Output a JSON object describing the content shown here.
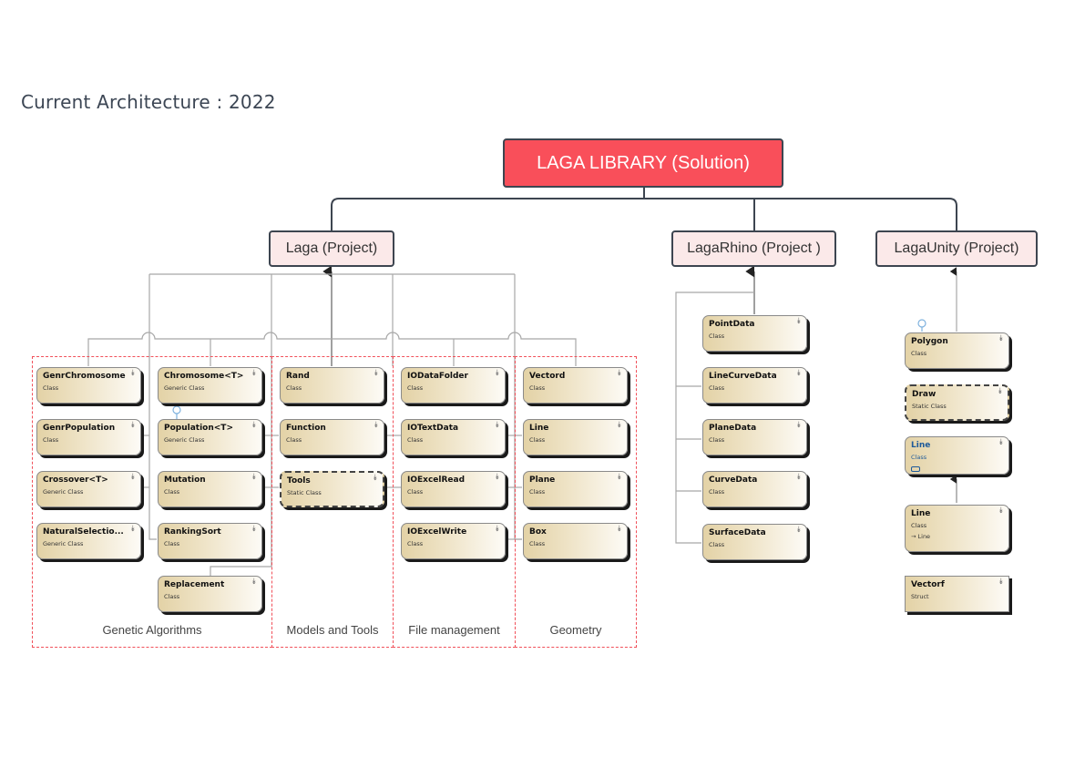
{
  "title": "Current Architecture : 2022",
  "solution": {
    "label": "LAGA LIBRARY (Solution)"
  },
  "projects": {
    "laga": "Laga (Project)",
    "rhino": "LagaRhino (Project )",
    "unity": "LagaUnity (Project)"
  },
  "groups": {
    "genetic": "Genetic Algorithms",
    "models": "Models and Tools",
    "files": "File management",
    "geometry": "Geometry"
  },
  "icons": {
    "expand": "»"
  },
  "classes": {
    "genrChromosome": {
      "name": "GenrChromosome",
      "kind": "Class"
    },
    "genrPopulation": {
      "name": "GenrPopulation",
      "kind": "Class"
    },
    "crossover": {
      "name": "Crossover<T>",
      "kind": "Generic Class"
    },
    "naturalSelection": {
      "name": "NaturalSelectio...",
      "kind": "Generic Class"
    },
    "chromosome": {
      "name": "Chromosome<T>",
      "kind": "Generic Class"
    },
    "population": {
      "name": "Population<T>",
      "kind": "Generic Class"
    },
    "mutation": {
      "name": "Mutation",
      "kind": "Class"
    },
    "rankingSort": {
      "name": "RankingSort",
      "kind": "Class"
    },
    "replacement": {
      "name": "Replacement",
      "kind": "Class"
    },
    "rand": {
      "name": "Rand",
      "kind": "Class"
    },
    "function": {
      "name": "Function",
      "kind": "Class"
    },
    "tools": {
      "name": "Tools",
      "kind": "Static Class"
    },
    "ioDataFolder": {
      "name": "IODataFolder",
      "kind": "Class"
    },
    "ioTextData": {
      "name": "IOTextData",
      "kind": "Class"
    },
    "ioExcelRead": {
      "name": "IOExcelRead",
      "kind": "Class"
    },
    "ioExcelWrite": {
      "name": "IOExcelWrite",
      "kind": "Class"
    },
    "vectord": {
      "name": "Vectord",
      "kind": "Class"
    },
    "line": {
      "name": "Line",
      "kind": "Class"
    },
    "plane": {
      "name": "Plane",
      "kind": "Class"
    },
    "box": {
      "name": "Box",
      "kind": "Class"
    },
    "pointData": {
      "name": "PointData",
      "kind": "Class"
    },
    "lineCurveData": {
      "name": "LineCurveData",
      "kind": "Class"
    },
    "planeData": {
      "name": "PlaneData",
      "kind": "Class"
    },
    "curveData": {
      "name": "CurveData",
      "kind": "Class"
    },
    "surfaceData": {
      "name": "SurfaceData",
      "kind": "Class"
    },
    "polygon": {
      "name": "Polygon",
      "kind": "Class"
    },
    "draw": {
      "name": "Draw",
      "kind": "Static Class"
    },
    "unityLineBase": {
      "name": "Line",
      "kind": "Class"
    },
    "unityLine": {
      "name": "Line",
      "kind": "Class",
      "inherits": "→ Line"
    },
    "vectorf": {
      "name": "Vectorf",
      "kind": "Struct"
    }
  }
}
